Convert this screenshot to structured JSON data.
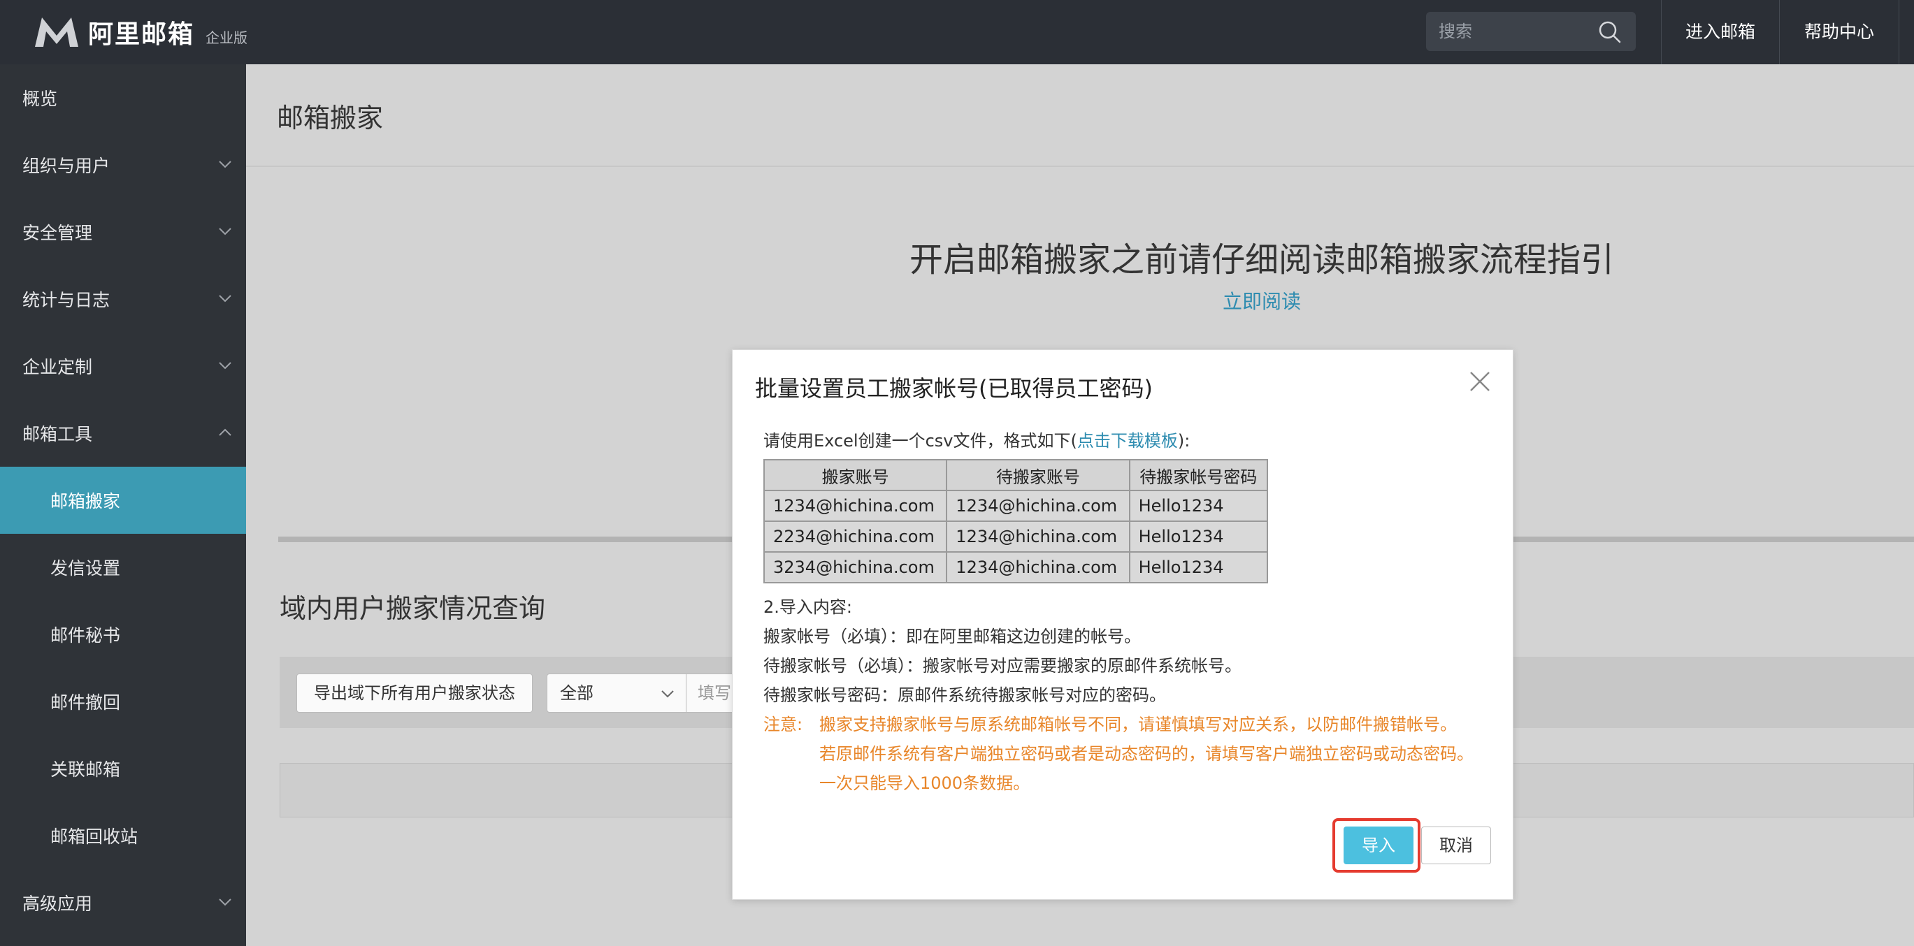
{
  "header": {
    "logo_text": "阿里邮箱",
    "logo_badge": "企业版",
    "search_placeholder": "搜索",
    "links": [
      "进入邮箱",
      "帮助中心"
    ]
  },
  "sidebar": {
    "items": [
      {
        "label": "概览"
      },
      {
        "label": "组织与用户"
      },
      {
        "label": "安全管理"
      },
      {
        "label": "统计与日志"
      },
      {
        "label": "企业定制"
      },
      {
        "label": "邮箱工具"
      },
      {
        "label": "邮箱搬家"
      },
      {
        "label": "发信设置"
      },
      {
        "label": "邮件秘书"
      },
      {
        "label": "邮件撤回"
      },
      {
        "label": "关联邮箱"
      },
      {
        "label": "邮箱回收站"
      },
      {
        "label": "高级应用"
      }
    ]
  },
  "main": {
    "page_title": "邮箱搬家",
    "headline": "开启邮箱搬家之前请仔细阅读邮箱搬家流程指引",
    "read_link": "立即阅读",
    "section_title": "域内用户搬家情况查询",
    "export_button": "导出域下所有用户搬家状态",
    "status_select": "全部",
    "filter_placeholder": "填写"
  },
  "modal": {
    "title": "批量设置员工搬家帐号(已取得员工密码)",
    "desc_prefix": "请使用Excel创建一个csv文件，格式如下(",
    "desc_link": "点击下载模板",
    "desc_suffix": "):",
    "table": {
      "headers": [
        "搬家账号",
        "待搬家账号",
        "待搬家帐号密码"
      ],
      "rows": [
        [
          "1234@hichina.com",
          "1234@hichina.com",
          "Hello1234"
        ],
        [
          "2234@hichina.com",
          "1234@hichina.com",
          "Hello1234"
        ],
        [
          "3234@hichina.com",
          "1234@hichina.com",
          "Hello1234"
        ]
      ]
    },
    "import_heading": "2.导入内容:",
    "lines": [
      "搬家帐号（必填）：即在阿里邮箱这边创建的帐号。",
      "待搬家帐号（必填）：搬家帐号对应需要搬家的原邮件系统帐号。",
      "待搬家帐号密码：原邮件系统待搬家帐号对应的密码。"
    ],
    "note_label": "注意:",
    "notes": [
      "搬家支持搬家帐号与原系统邮箱帐号不同，请谨慎填写对应关系，以防邮件搬错帐号。",
      "若原邮件系统有客户端独立密码或者是动态密码的，请填写客户端独立密码或动态密码。",
      "一次只能导入1000条数据。"
    ],
    "import_button": "导入",
    "cancel_button": "取消"
  },
  "colors": {
    "topbar": "#2b2f36",
    "sidebar": "#2f3338",
    "active": "#3c9bb3",
    "link": "#2e8cb0",
    "warning": "#e8862a",
    "primary_button": "#4cc0df",
    "highlight": "#e53b2f"
  }
}
